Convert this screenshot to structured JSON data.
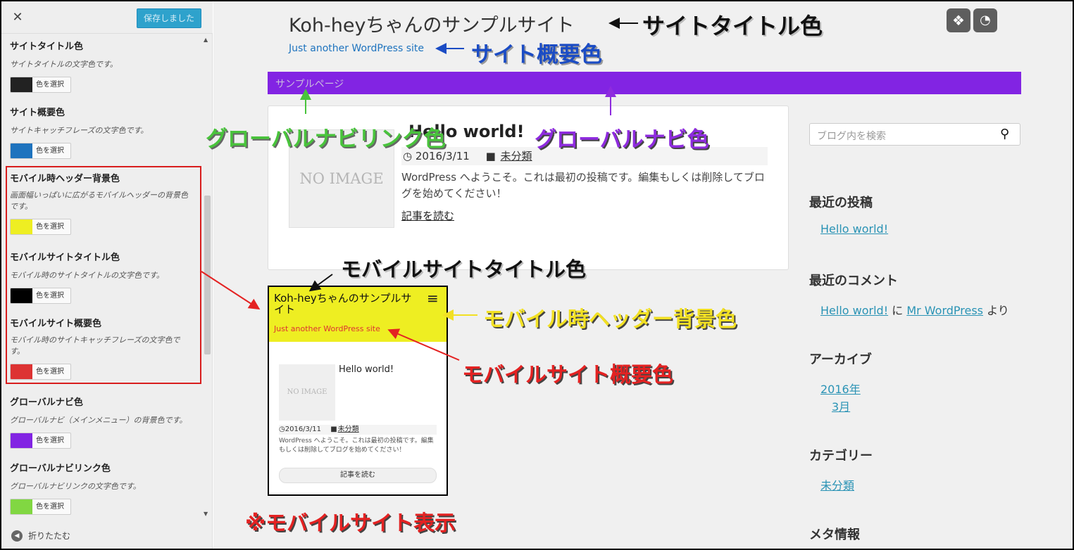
{
  "panel": {
    "close_glyph": "✕",
    "saved_label": "保存しました",
    "color_button_label": "色を選択",
    "collapse_label": "折りたたむ",
    "settings": [
      {
        "title": "サイトタイトル色",
        "desc": "サイトタイトルの文字色です。",
        "color": "#222222"
      },
      {
        "title": "サイト概要色",
        "desc": "サイトキャッチフレーズの文字色です。",
        "color": "#1e73be"
      },
      {
        "title": "モバイル時ヘッダー背景色",
        "desc": "画面幅いっぱいに広がるモバイルヘッダーの背景色です。",
        "color": "#eeee22"
      },
      {
        "title": "モバイルサイトタイトル色",
        "desc": "モバイル時のサイトタイトルの文字色です。",
        "color": "#000000"
      },
      {
        "title": "モバイルサイト概要色",
        "desc": "モバイル時のサイトキャッチフレーズの文字色です。",
        "color": "#dd3333"
      },
      {
        "title": "グローバルナビ色",
        "desc": "グローバルナビ（メインメニュー）の背景色です。",
        "color": "#8224e3"
      },
      {
        "title": "グローバルナビリンク色",
        "desc": "グローバルナビリンクの文字色です。",
        "color": "#81d742"
      }
    ]
  },
  "site": {
    "title": "Koh-heyちゃんのサンプルサイト",
    "description": "Just another WordPress site",
    "nav": [
      "サンプルページ"
    ]
  },
  "post": {
    "title": "Hello world!",
    "date": "2016/3/11",
    "category": "未分類",
    "excerpt": "WordPress へようこそ。これは最初の投稿です。編集もしくは削除してブログを始めてください！",
    "read_more": "記事を読む",
    "thumb_text": "NO IMAGE"
  },
  "mobile": {
    "title": "Koh-heyちゃんのサンプルサイト",
    "description": "Just another WordPress site",
    "menu_glyph": "≡",
    "thumb_text": "NO IMAGE",
    "post_title": "Hello world!",
    "date": "2016/3/11",
    "category": "未分類",
    "excerpt": "WordPress へようこそ。これは最初の投稿です。編集もしくは削除してブログを始めてください！",
    "read_more": "記事を読む"
  },
  "sidebar": {
    "search_placeholder": "ブログ内を検索",
    "recent_posts_title": "最近の投稿",
    "recent_post": "Hello world!",
    "recent_comments_title": "最近のコメント",
    "comment_post": "Hello world!",
    "comment_on": "に",
    "comment_author": "Mr WordPress",
    "comment_from": "より",
    "archives_title": "アーカイブ",
    "archive_year": "2016年",
    "archive_month": "3月",
    "categories_title": "カテゴリー",
    "category": "未分類",
    "meta_title": "メタ情報"
  },
  "annotations": {
    "site_title_color": "サイトタイトル色",
    "site_desc_color": "サイト概要色",
    "nav_link_color": "グローバルナビリンク色",
    "nav_color": "グローバルナビ色",
    "mobile_title_color": "モバイルサイトタイトル色",
    "mobile_header_bg": "モバイル時ヘッダー背景色",
    "mobile_desc_color": "モバイルサイト概要色",
    "mobile_display_note": "※モバイルサイト表示"
  }
}
